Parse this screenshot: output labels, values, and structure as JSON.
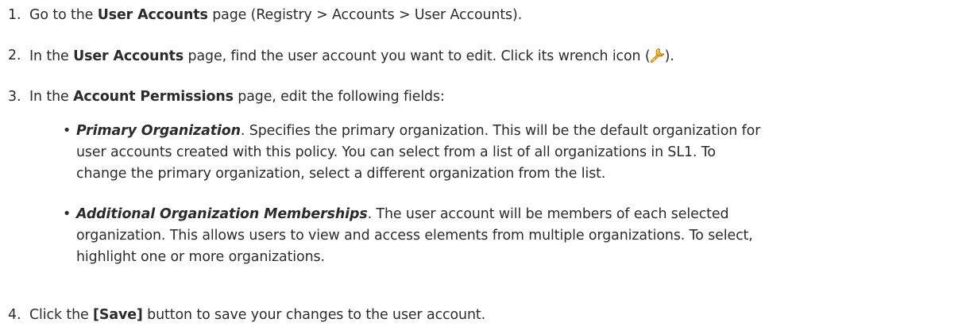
{
  "steps": [
    {
      "number": "1.",
      "pre": "Go to the ",
      "bold": "User Accounts",
      "post": " page (Registry > Accounts > User Accounts)."
    },
    {
      "number": "2.",
      "pre": "In the ",
      "bold": "User Accounts",
      "post": " page, find the user account you want to edit. Click its wrench icon (",
      "after_icon": ").",
      "icon": "wrench-icon"
    },
    {
      "number": "3.",
      "pre": "In the ",
      "bold": "Account Permissions",
      "post": " page, edit the following fields:"
    },
    {
      "number": "4.",
      "pre": "Click the ",
      "bold": "[Save]",
      "post": " button to save your changes to the user account."
    }
  ],
  "bullets": [
    {
      "term": "Primary Organization",
      "lines": [
        ". Specifies the primary organization. This will be the default organization for",
        "user accounts created with this policy. You can select from a list of all organizations in SL1. To",
        "change the primary organization, select a different organization from the list."
      ]
    },
    {
      "term": "Additional Organization Memberships",
      "lines": [
        ". The user account will be members of each selected",
        "organization. This allows users to view and access elements from multiple organizations. To select,",
        "highlight one or more organizations."
      ]
    }
  ],
  "colors": {
    "text": "#2b2b2b",
    "icon_orange": "#e8a317"
  }
}
